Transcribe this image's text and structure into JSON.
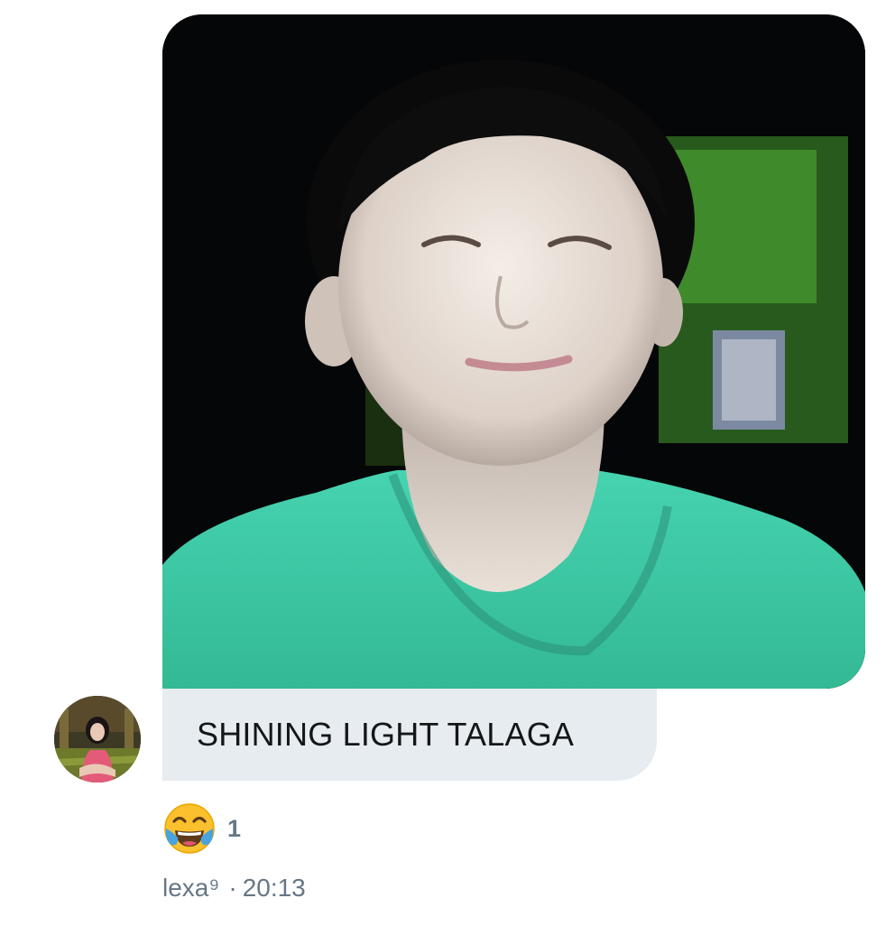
{
  "message": {
    "text": "SHINING LIGHT TALAGA",
    "sender": "lexa⁹",
    "separator": "·",
    "time": "20:13",
    "reaction": {
      "emoji_name": "face-with-tears-of-joy-icon",
      "count": "1"
    },
    "attachment": {
      "type": "photo"
    },
    "avatar": {
      "icon": "user-avatar"
    }
  },
  "colors": {
    "bubble_bg": "#e6ecf0",
    "text": "#14171a",
    "meta_text": "#657786",
    "shirt": "#3fcaa7"
  }
}
